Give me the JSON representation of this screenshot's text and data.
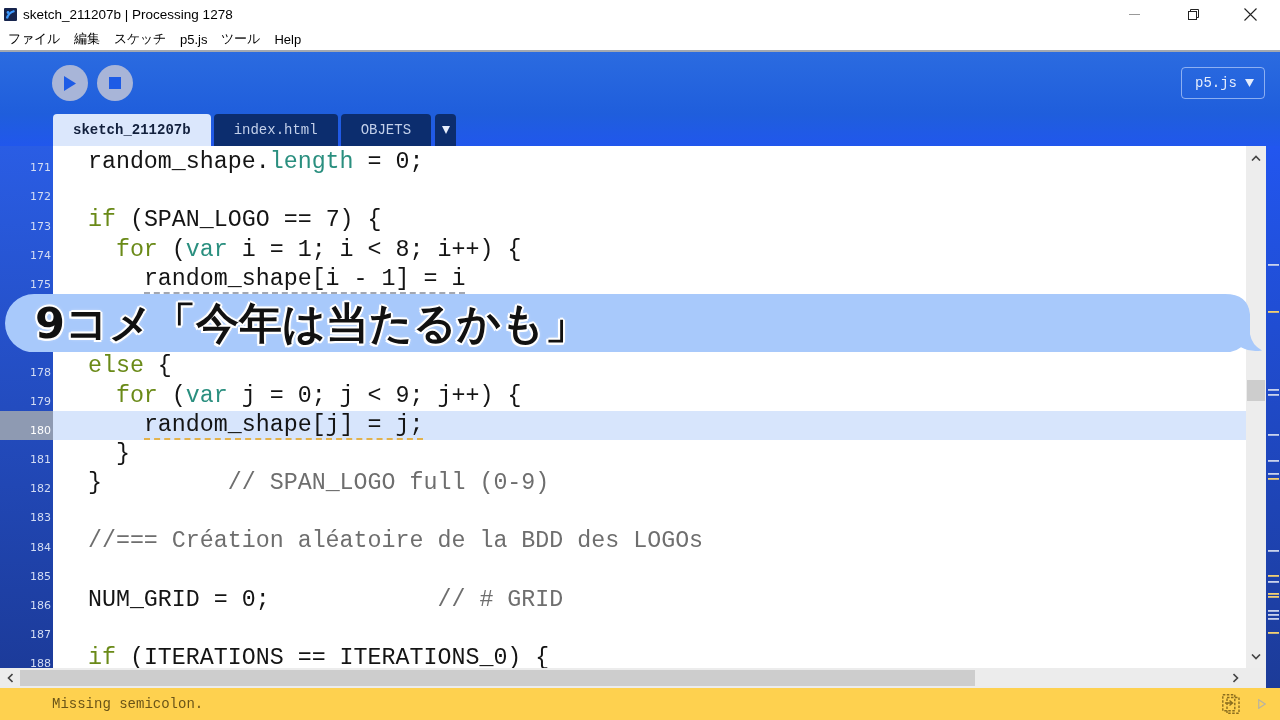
{
  "window": {
    "title": "sketch_211207b | Processing 1278"
  },
  "menu": [
    "ファイル",
    "編集",
    "スケッチ",
    "p5.js",
    "ツール",
    "Help"
  ],
  "toolbar": {
    "mode_button": "p5.js"
  },
  "tabs": [
    {
      "label": "sketch_211207b",
      "selected": true
    },
    {
      "label": "index.html",
      "selected": false
    },
    {
      "label": "OBJETS",
      "selected": false
    }
  ],
  "editor": {
    "lines_above_comment": [
      {
        "number": "171",
        "current": false,
        "tokens": [
          {
            "kind": "plain",
            "text": "  random_shape."
          },
          {
            "kind": "property",
            "text": "length"
          },
          {
            "kind": "plain",
            "text": " = 0;"
          }
        ]
      },
      {
        "number": "172",
        "current": false
      },
      {
        "number": "173",
        "current": false,
        "tokens": [
          {
            "kind": "keyword",
            "text": "  if"
          },
          {
            "kind": "plain",
            "text": " (SPAN_LOGO == 7) {"
          }
        ]
      },
      {
        "number": "174",
        "current": false,
        "tokens": [
          {
            "kind": "keyword",
            "text": "    for"
          },
          {
            "kind": "plain",
            "text": " ("
          },
          {
            "kind": "type",
            "text": "var"
          },
          {
            "kind": "plain",
            "text": " i = 1; i < 8; i++) {"
          }
        ]
      },
      {
        "number": "175",
        "current": false,
        "underline": {
          "color": "#a3a7b0"
        },
        "tokens": [
          {
            "kind": "plain",
            "text": "      random_shape[i - 1] = i"
          }
        ]
      }
    ],
    "lines_below_comment": [
      {
        "number": "178",
        "current": false,
        "tokens": [
          {
            "kind": "keyword",
            "text": "  else"
          },
          {
            "kind": "plain",
            "text": " {"
          }
        ]
      },
      {
        "number": "179",
        "current": false,
        "tokens": [
          {
            "kind": "keyword",
            "text": "    for"
          },
          {
            "kind": "plain",
            "text": " ("
          },
          {
            "kind": "type",
            "text": "var"
          },
          {
            "kind": "plain",
            "text": " j = 0; j < 9; j++) {"
          }
        ]
      },
      {
        "number": "180",
        "current": true,
        "underline": {
          "color": "#e2b24c"
        },
        "tokens": [
          {
            "kind": "plain",
            "text": "      random_shape[j] = j;"
          }
        ]
      },
      {
        "number": "181",
        "current": false,
        "tokens": [
          {
            "kind": "plain",
            "text": "    }"
          }
        ]
      },
      {
        "number": "182",
        "current": false,
        "tokens": [
          {
            "kind": "plain",
            "text": "  }         "
          },
          {
            "kind": "comment",
            "text": "// SPAN_LOGO full (0-9)"
          }
        ]
      },
      {
        "number": "183",
        "current": false
      },
      {
        "number": "184",
        "current": false,
        "tokens": [
          {
            "kind": "comment",
            "text": "  //=== Création aléatoire de la BDD des LOGOs"
          }
        ]
      },
      {
        "number": "185",
        "current": false
      },
      {
        "number": "186",
        "current": false,
        "tokens": [
          {
            "kind": "plain",
            "text": "  NUM_GRID = 0;            "
          },
          {
            "kind": "comment",
            "text": "// # GRID"
          }
        ]
      },
      {
        "number": "187",
        "current": false
      },
      {
        "number": "188",
        "current": false,
        "tokens": [
          {
            "kind": "keyword",
            "text": "  if"
          },
          {
            "kind": "plain",
            "text": " (ITERATIONS == ITERATIONS_0) {"
          }
        ]
      }
    ]
  },
  "comment_overlay": {
    "text": "9コメ「今年は当たるかも」"
  },
  "status_bar": {
    "kind": "warning",
    "message": "Missing semicolon."
  }
}
